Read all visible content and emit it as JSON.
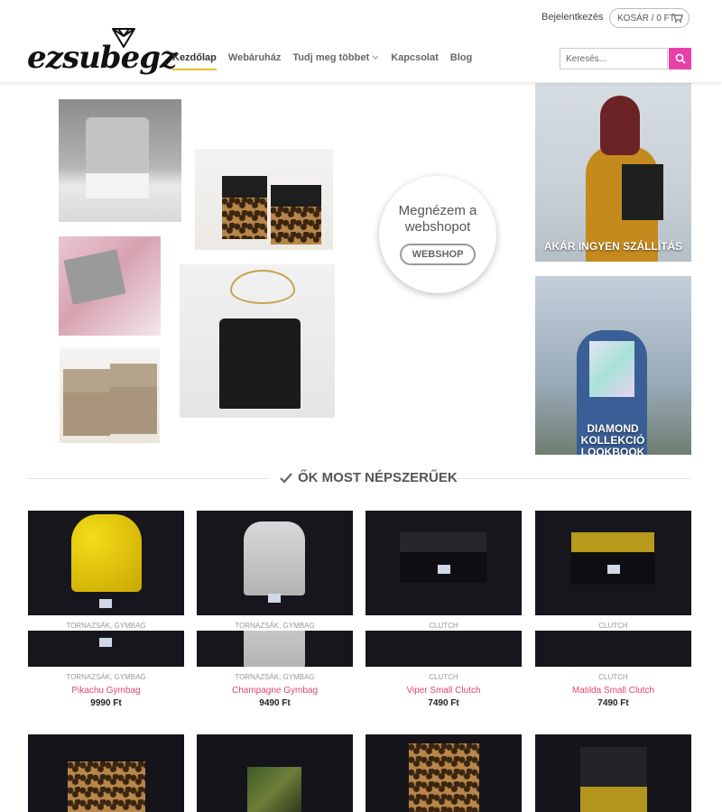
{
  "header": {
    "login": "Bejelentkezés",
    "cart": "KOSÁR / 0 FT",
    "logo_text": "ezsubegz",
    "nav": [
      "Kezdőlap",
      "Webáruház",
      "Tudj meg többet",
      "Kapcsolat",
      "Blog"
    ],
    "search_placeholder": "Keresés..."
  },
  "hero": {
    "circle_text": "Megnézem a webshopot",
    "circle_button": "WEBSHOP",
    "side_captions": [
      "AKÁR INGYEN SZÁLLÍTÁS",
      "DIAMOND KOLLEKCIÓ LOOKBOOK"
    ]
  },
  "section": {
    "title": "ŐK MOST NÉPSZERŰEK"
  },
  "products": [
    {
      "category": "TORNAZSÁK, GYMBAG",
      "name": "Pikachu Gymbag",
      "price": "9990 Ft"
    },
    {
      "category": "TORNAZSÁK, GYMBAG",
      "name": "Champagne Gymbag",
      "price": "9490 Ft"
    },
    {
      "category": "CLUTCH",
      "name": "Viper Small Clutch",
      "price": "7490 Ft"
    },
    {
      "category": "CLUTCH",
      "name": "Matilda Small Clutch",
      "price": "7490 Ft"
    }
  ],
  "colors": {
    "accent": "#e83fa9",
    "price_link": "#e2466a",
    "nav_underline": "#e5c229"
  },
  "icons": [
    "cart-icon",
    "search-icon",
    "diamond-logo-icon",
    "checkmark-icon",
    "chevron-down-icon"
  ]
}
